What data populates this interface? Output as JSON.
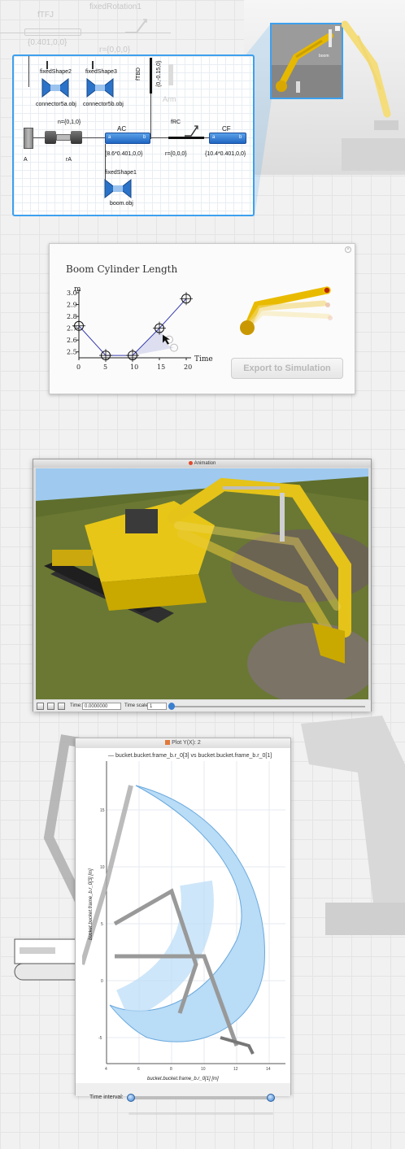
{
  "top_strip": {
    "labels": [
      "fTFJ",
      "fixedRotation1",
      "{0.401,0,0}",
      "r={0,0,0}"
    ]
  },
  "diagram": {
    "fixed_shape_2": "fixedShape2",
    "fixed_shape_3": "fixedShape3",
    "connector_a": "connector5a.obj",
    "connector_b": "connector5b.obj",
    "ftbd_label": "fTBD",
    "ftbd_vec": "{0,-0.15,0}",
    "arm_label": "Arm",
    "n_label": "n={0,1,0}",
    "ac_label": "AC",
    "frc_label": "fRC",
    "cf_label": "CF",
    "a_label": "A",
    "ra_label": "rA",
    "ac_vec": "{8.6*0.401,0,0}",
    "r_zero": "r={0,0,0}",
    "cf_vec": "{10.4*0.401,0,0}",
    "fixed_shape_1": "fixedShape1",
    "boom_obj": "boom.obj",
    "port_a": "a",
    "port_b": "b"
  },
  "thumbnail": {
    "boom_label": "boom"
  },
  "graph_dialog": {
    "title": "Boom Cylinder Length",
    "export_label": "Export to Simulation",
    "y_unit": "m",
    "x_label": "Time"
  },
  "chart_data": {
    "type": "line",
    "title": "Boom Cylinder Length",
    "xlabel": "Time",
    "ylabel": "m",
    "x_ticks": [
      0,
      5,
      10,
      15,
      20
    ],
    "y_ticks": [
      2.5,
      2.6,
      2.7,
      2.8,
      2.9,
      3.0
    ],
    "xlim": [
      0,
      20
    ],
    "ylim": [
      2.45,
      3.0
    ],
    "series": [
      {
        "x": [
          0,
          5,
          10,
          15,
          20
        ],
        "y": [
          2.72,
          2.47,
          2.47,
          2.7,
          2.95
        ]
      }
    ]
  },
  "animation": {
    "title": "Animation",
    "time_label": "Time:",
    "time_value": "0.0000000",
    "scale_label": "Time scale:",
    "scale_value": "1"
  },
  "plot": {
    "title": "Plot Y(X): 2",
    "legend": "bucket.bucket.frame_b.r_0[3] vs bucket.bucket.frame_b.r_0[1]",
    "x_axis_label": "bucket.bucket.frame_b.r_0[1] [m]",
    "y_axis_label": "bucket.bucket.frame_b.r_0[3] [m]",
    "x_ticks": [
      "4",
      "6",
      "8",
      "10",
      "12",
      "14"
    ],
    "y_ticks": [
      "15",
      "10",
      "5",
      "0",
      "-5"
    ],
    "time_interval_label": "Time interval:"
  },
  "colors": {
    "accent_blue": "#3da0ee",
    "boom_yellow": "#f2c200",
    "plot_fill": "#b9dcf7"
  }
}
